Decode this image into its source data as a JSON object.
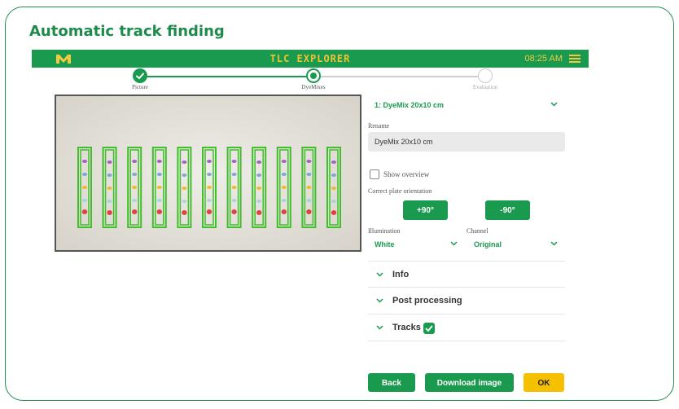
{
  "heading": "Automatic track finding",
  "appbar": {
    "title": "TLC EXPLORER",
    "time": "08:25 AM",
    "logo_icon": "merck-m-logo",
    "menu_icon": "hamburger-menu-icon",
    "brand_color": "#1a9a4f",
    "accent_color": "#f2c230"
  },
  "stepper": {
    "steps": [
      {
        "label": "Picture",
        "state": "done"
      },
      {
        "label": "DyeMixes",
        "state": "current"
      },
      {
        "label": "Evaluation",
        "state": "pending"
      }
    ]
  },
  "plate": {
    "track_count": 11,
    "band_colors": [
      "#a24fc8",
      "#6fa0d8",
      "#f2b21a",
      "#8fd0e0",
      "#e03030"
    ]
  },
  "panel": {
    "dyemix_select": "1: DyeMix 20x10 cm",
    "rename_label": "Rename",
    "rename_value": "DyeMix 20x10 cm",
    "show_overview_label": "Show overview",
    "orientation_label": "Correct plate orientation",
    "rotate_plus": "+90°",
    "rotate_minus": "-90°",
    "illumination_label": "Illumination",
    "illumination_value": "White",
    "channel_label": "Channel",
    "channel_value": "Original",
    "sections": {
      "info": "Info",
      "post_processing": "Post processing",
      "tracks": "Tracks"
    }
  },
  "footer": {
    "back": "Back",
    "download": "Download image",
    "ok": "OK"
  }
}
